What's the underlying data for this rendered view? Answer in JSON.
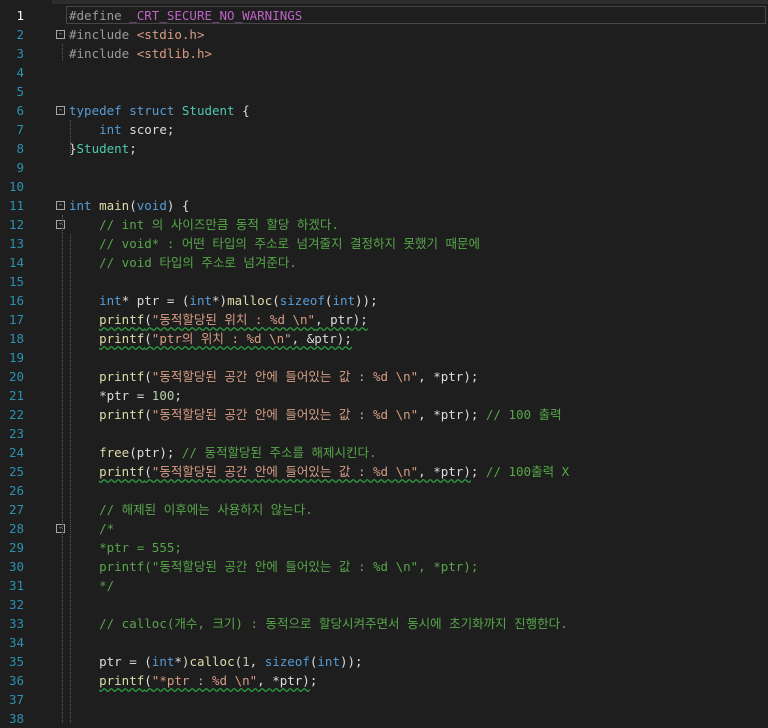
{
  "editor": {
    "active_line": 1,
    "lines": [
      {
        "n": "1",
        "parts": [
          [
            "pp",
            "#define "
          ],
          [
            "mac",
            "_CRT_SECURE_NO_WARNINGS"
          ]
        ]
      },
      {
        "n": "2",
        "fold": "-",
        "parts": [
          [
            "pp",
            "#include "
          ],
          [
            "str",
            "<stdio.h>"
          ]
        ]
      },
      {
        "n": "3",
        "parts": [
          [
            "pp",
            "#include "
          ],
          [
            "str",
            "<stdlib.h>"
          ]
        ]
      },
      {
        "n": "4",
        "parts": []
      },
      {
        "n": "5",
        "parts": []
      },
      {
        "n": "6",
        "fold": "-",
        "parts": [
          [
            "kw",
            "typedef "
          ],
          [
            "kw",
            "struct "
          ],
          [
            "type",
            "Student"
          ],
          [
            "plain",
            " {"
          ]
        ]
      },
      {
        "n": "7",
        "parts": [
          [
            "plain",
            "    "
          ],
          [
            "kw",
            "int "
          ],
          [
            "plain",
            "score;"
          ]
        ]
      },
      {
        "n": "8",
        "parts": [
          [
            "plain",
            "}"
          ],
          [
            "type",
            "Student"
          ],
          [
            "plain",
            ";"
          ]
        ]
      },
      {
        "n": "9",
        "parts": []
      },
      {
        "n": "10",
        "parts": []
      },
      {
        "n": "11",
        "fold": "-",
        "parts": [
          [
            "kw",
            "int "
          ],
          [
            "fn",
            "main"
          ],
          [
            "plain",
            "("
          ],
          [
            "kw",
            "void"
          ],
          [
            "plain",
            ") {"
          ]
        ]
      },
      {
        "n": "12",
        "fold": "-",
        "parts": [
          [
            "plain",
            "    "
          ],
          [
            "com",
            "// int 의 사이즈만큼 동적 할당 하겠다."
          ]
        ]
      },
      {
        "n": "13",
        "parts": [
          [
            "plain",
            "    "
          ],
          [
            "com",
            "// void* : 어떤 타입의 주소로 넘겨줄지 결정하지 못했기 때문에"
          ]
        ]
      },
      {
        "n": "14",
        "parts": [
          [
            "plain",
            "    "
          ],
          [
            "com",
            "// void 타입의 주소로 넘겨준다."
          ]
        ]
      },
      {
        "n": "15",
        "parts": []
      },
      {
        "n": "16",
        "parts": [
          [
            "plain",
            "    "
          ],
          [
            "kw",
            "int"
          ],
          [
            "plain",
            "* ptr = ("
          ],
          [
            "kw",
            "int"
          ],
          [
            "plain",
            "*)"
          ],
          [
            "fn",
            "malloc"
          ],
          [
            "plain",
            "("
          ],
          [
            "kw",
            "sizeof"
          ],
          [
            "plain",
            "("
          ],
          [
            "kw",
            "int"
          ],
          [
            "plain",
            "));"
          ]
        ]
      },
      {
        "n": "17",
        "parts": [
          [
            "plain",
            "    "
          ],
          [
            "fn sq",
            "printf"
          ],
          [
            "plain sq",
            "("
          ],
          [
            "str sq",
            "\"동적할당된 위치 : %d \\n\""
          ],
          [
            "plain sq",
            ", ptr);"
          ]
        ]
      },
      {
        "n": "18",
        "parts": [
          [
            "plain",
            "    "
          ],
          [
            "fn sq",
            "printf"
          ],
          [
            "plain sq",
            "("
          ],
          [
            "str sq",
            "\"ptr의 위치 : %d \\n\""
          ],
          [
            "plain sq",
            ", &ptr);"
          ]
        ]
      },
      {
        "n": "19",
        "parts": []
      },
      {
        "n": "20",
        "parts": [
          [
            "plain",
            "    "
          ],
          [
            "fn",
            "printf"
          ],
          [
            "plain",
            "("
          ],
          [
            "str",
            "\"동적할당된 공간 안에 들어있는 값 : %d \\n\""
          ],
          [
            "plain",
            ", *ptr);"
          ]
        ]
      },
      {
        "n": "21",
        "parts": [
          [
            "plain",
            "    *ptr = "
          ],
          [
            "num",
            "100"
          ],
          [
            "plain",
            ";"
          ]
        ]
      },
      {
        "n": "22",
        "parts": [
          [
            "plain",
            "    "
          ],
          [
            "fn",
            "printf"
          ],
          [
            "plain",
            "("
          ],
          [
            "str",
            "\"동적할당된 공간 안에 들어있는 값 : %d \\n\""
          ],
          [
            "plain",
            ", *ptr); "
          ],
          [
            "com",
            "// 100 출력"
          ]
        ]
      },
      {
        "n": "23",
        "parts": []
      },
      {
        "n": "24",
        "parts": [
          [
            "plain",
            "    "
          ],
          [
            "fn",
            "free"
          ],
          [
            "plain",
            "(ptr); "
          ],
          [
            "com",
            "// 동적할당된 주소를 해제시킨다."
          ]
        ]
      },
      {
        "n": "25",
        "parts": [
          [
            "plain",
            "    "
          ],
          [
            "fn sq",
            "printf"
          ],
          [
            "plain sq",
            "("
          ],
          [
            "str sq",
            "\"동적할당된 공간 안에 들어있는 값 : %d \\n\""
          ],
          [
            "plain sq",
            ", *ptr)"
          ],
          [
            "plain",
            "; "
          ],
          [
            "com",
            "// 100출력 X"
          ]
        ]
      },
      {
        "n": "26",
        "parts": []
      },
      {
        "n": "27",
        "parts": [
          [
            "plain",
            "    "
          ],
          [
            "com",
            "// 해제된 이후에는 사용하지 않는다."
          ]
        ]
      },
      {
        "n": "28",
        "fold": "-",
        "parts": [
          [
            "plain",
            "    "
          ],
          [
            "com",
            "/*"
          ]
        ]
      },
      {
        "n": "29",
        "parts": [
          [
            "plain",
            "    "
          ],
          [
            "com",
            "*ptr = 555;"
          ]
        ]
      },
      {
        "n": "30",
        "parts": [
          [
            "plain",
            "    "
          ],
          [
            "com",
            "printf(\"동적할당된 공간 안에 들어있는 값 : %d \\n\", *ptr);"
          ]
        ]
      },
      {
        "n": "31",
        "parts": [
          [
            "plain",
            "    "
          ],
          [
            "com",
            "*/"
          ]
        ]
      },
      {
        "n": "32",
        "parts": []
      },
      {
        "n": "33",
        "parts": [
          [
            "plain",
            "    "
          ],
          [
            "com",
            "// calloc(개수, 크기) : 동적으로 할당시켜주면서 동시에 초기화까지 진행한다."
          ]
        ]
      },
      {
        "n": "34",
        "parts": []
      },
      {
        "n": "35",
        "parts": [
          [
            "plain",
            "    ptr = ("
          ],
          [
            "kw",
            "int"
          ],
          [
            "plain",
            "*)"
          ],
          [
            "fn",
            "calloc"
          ],
          [
            "plain",
            "("
          ],
          [
            "num",
            "1"
          ],
          [
            "plain",
            ", "
          ],
          [
            "kw",
            "sizeof"
          ],
          [
            "plain",
            "("
          ],
          [
            "kw",
            "int"
          ],
          [
            "plain",
            "));"
          ]
        ]
      },
      {
        "n": "36",
        "parts": [
          [
            "plain",
            "    "
          ],
          [
            "fn sq",
            "printf"
          ],
          [
            "plain sq",
            "("
          ],
          [
            "str sq",
            "\"*ptr : %d \\n\""
          ],
          [
            "plain sq",
            ", *ptr)"
          ],
          [
            "plain",
            ";"
          ]
        ]
      },
      {
        "n": "37",
        "parts": []
      },
      {
        "n": "38",
        "parts": []
      }
    ]
  }
}
